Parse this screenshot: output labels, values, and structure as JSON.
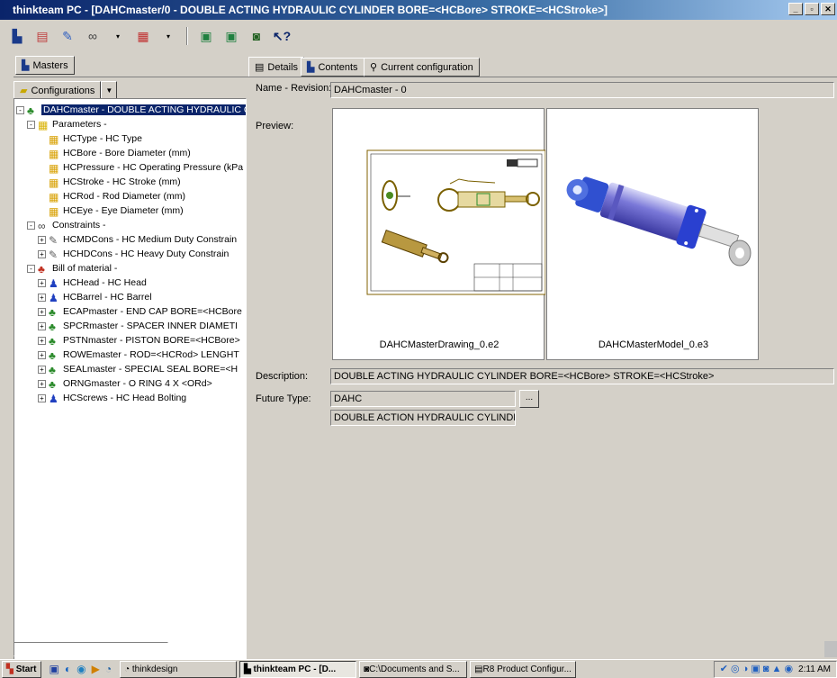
{
  "window": {
    "title": "thinkteam PC - [DAHCmaster/0 - DOUBLE ACTING HYDRAULIC CYLINDER BORE=<HCBore> STROKE=<HCStroke>]"
  },
  "left_panel": {
    "tab_masters": "Masters",
    "configurations_label": "Configurations",
    "tree": [
      {
        "label": "DAHCmaster - DOUBLE ACTING HYDRAULIC C",
        "level": 0,
        "icon": "assembly-icon",
        "expander": "-"
      },
      {
        "label": "Parameters -",
        "level": 1,
        "icon": "parameters-icon",
        "expander": "-"
      },
      {
        "label": "HCType - HC Type",
        "level": 2,
        "icon": "parameter-icon",
        "expander": ""
      },
      {
        "label": "HCBore - Bore Diameter (mm)",
        "level": 2,
        "icon": "parameter-icon",
        "expander": ""
      },
      {
        "label": "HCPressure - HC Operating Pressure (kPa",
        "level": 2,
        "icon": "parameter-icon",
        "expander": ""
      },
      {
        "label": "HCStroke - HC Stroke (mm)",
        "level": 2,
        "icon": "parameter-icon",
        "expander": ""
      },
      {
        "label": "HCRod - Rod Diameter (mm)",
        "level": 2,
        "icon": "parameter-icon",
        "expander": ""
      },
      {
        "label": "HCEye - Eye Diameter (mm)",
        "level": 2,
        "icon": "parameter-icon",
        "expander": ""
      },
      {
        "label": "Constraints -",
        "level": 1,
        "icon": "constraints-icon",
        "expander": "-"
      },
      {
        "label": "HCMDCons - HC Medium Duty Constrain",
        "level": 2,
        "icon": "constraint-icon",
        "expander": "+"
      },
      {
        "label": "HCHDCons - HC Heavy Duty Constrain",
        "level": 2,
        "icon": "constraint-icon",
        "expander": "+"
      },
      {
        "label": "Bill of material -",
        "level": 1,
        "icon": "bom-icon",
        "expander": "-"
      },
      {
        "label": "HCHead - HC Head",
        "level": 2,
        "icon": "part-icon",
        "expander": "+"
      },
      {
        "label": "HCBarrel - HC Barrel",
        "level": 2,
        "icon": "part-icon",
        "expander": "+"
      },
      {
        "label": "ECAPmaster - END CAP BORE=<HCBore",
        "level": 2,
        "icon": "assembly-icon",
        "expander": "+"
      },
      {
        "label": "SPCRmaster - SPACER INNER DIAMETI",
        "level": 2,
        "icon": "assembly-icon",
        "expander": "+"
      },
      {
        "label": "PSTNmaster - PISTON BORE=<HCBore>",
        "level": 2,
        "icon": "assembly-icon",
        "expander": "+"
      },
      {
        "label": "ROWEmaster - ROD=<HCRod> LENGHT",
        "level": 2,
        "icon": "assembly-icon",
        "expander": "+"
      },
      {
        "label": "SEALmaster - SPECIAL SEAL BORE=<H",
        "level": 2,
        "icon": "assembly-icon",
        "expander": "+"
      },
      {
        "label": "ORNGmaster - O RING 4 X <ORd>",
        "level": 2,
        "icon": "assembly-icon",
        "expander": "+"
      },
      {
        "label": "HCScrews - HC Head Bolting",
        "level": 2,
        "icon": "part-icon",
        "expander": "+"
      }
    ]
  },
  "right_panel": {
    "tabs": [
      "Details",
      "Contents",
      "Current configuration"
    ],
    "name_revision_label": "Name - Revision:",
    "name_revision_value": "DAHCmaster - 0",
    "preview_label": "Preview:",
    "preview1_caption": "DAHCMasterDrawing_0.e2",
    "preview2_caption": "DAHCMasterModel_0.e3",
    "description_label": "Description:",
    "description_value": "DOUBLE ACTING HYDRAULIC CYLINDER BORE=<HCBore> STROKE=<HCStroke>",
    "future_type_label": "Future Type:",
    "future_type_value": "DAHC",
    "future_type_desc": "DOUBLE ACTION HYDRAULIC CYLINDER",
    "browse_button": "..."
  },
  "taskbar": {
    "start": "Start",
    "tasks": [
      "thinkdesign",
      "thinkteam PC - [D...",
      "C:\\Documents and S...",
      "R8 Product Configur..."
    ],
    "clock": "2:11 AM"
  }
}
